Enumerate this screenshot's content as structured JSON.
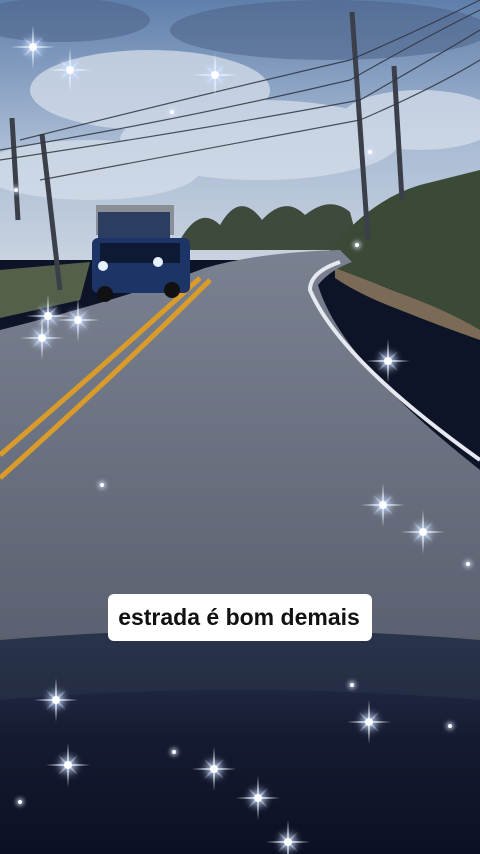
{
  "caption": {
    "text": "estrada é bom demais"
  },
  "colors": {
    "sky_top": "#6f8fb8",
    "sky_bottom": "#b9c8dc",
    "road": "#6d7482",
    "lane_marking": "#e0a22a",
    "edge_line": "#e8ecf2",
    "truck": "#1f3b6e",
    "caption_bg": "#ffffff",
    "caption_text": "#111111"
  }
}
